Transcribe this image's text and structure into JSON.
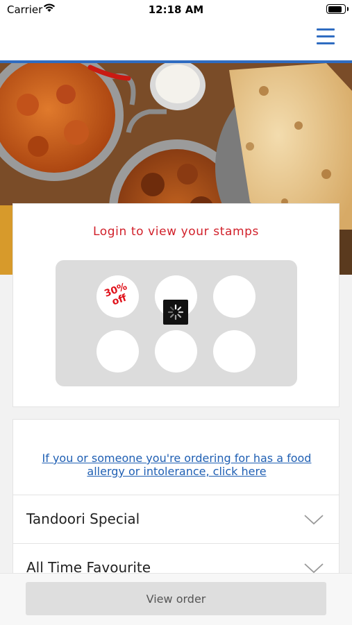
{
  "status_bar": {
    "carrier": "Carrier",
    "time": "12:18 AM",
    "battery_level": 0.95
  },
  "header": {
    "menu_icon": "hamburger-menu-icon",
    "accent_color": "#2f6cc1"
  },
  "hero": {
    "image": "indian-food-banner"
  },
  "stamps": {
    "title": "Login to view your stamps",
    "title_color": "#d1202a",
    "reward_label_line1": "30%",
    "reward_label_line2": "off",
    "loading_icon": "spinner-icon"
  },
  "allergy": {
    "link_text": "If you or someone you're ordering for has a food allergy or intolerance, click here"
  },
  "categories": [
    {
      "label": "Tandoori Special",
      "icon": "chevron-down-icon"
    },
    {
      "label": "All Time Favourite",
      "icon": "chevron-down-icon"
    }
  ],
  "footer": {
    "view_order_label": "View order"
  }
}
